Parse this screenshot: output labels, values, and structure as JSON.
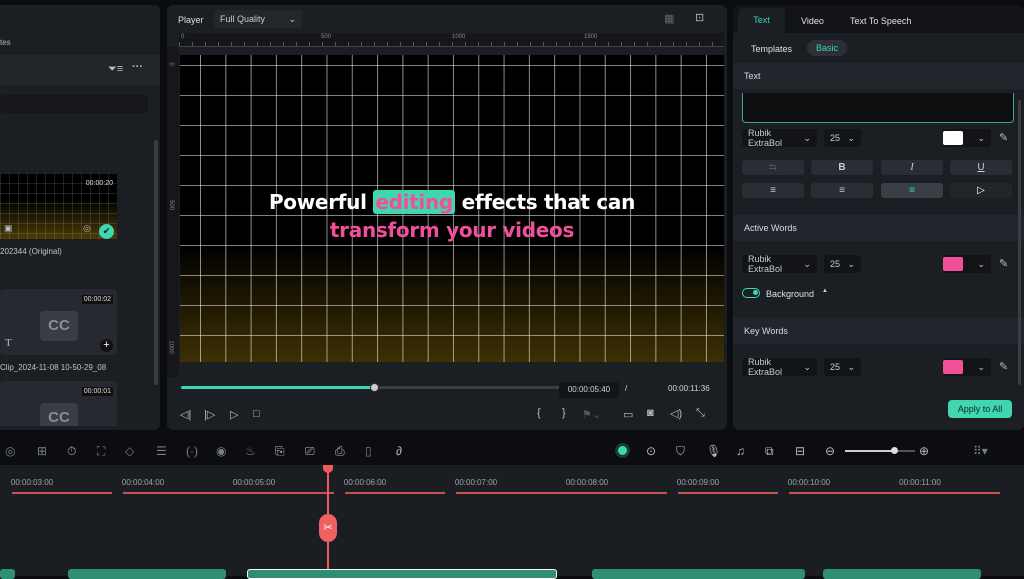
{
  "media": {
    "tab_partial": "tes",
    "clips": [
      {
        "duration": "00:00:20",
        "name": "202344 (Original)"
      },
      {
        "duration": "00:00:02",
        "name": "Clip_2024-11-08 10-50-29_08",
        "badge": "CC"
      },
      {
        "duration": "00:00:01",
        "badge": "CC"
      }
    ]
  },
  "player": {
    "label": "Player",
    "quality": "Full Quality",
    "ruler_h": [
      "0",
      "500",
      "1000",
      "1500"
    ],
    "ruler_v": [
      "0",
      "500",
      "1000"
    ],
    "caption": {
      "before": "Powerful",
      "active": "editing",
      "after": "effects that can",
      "line2": "transform your videos"
    },
    "current_time": "00:00:05:40",
    "separator": "/",
    "total_time": "00:00:11:36",
    "progress": 0.49
  },
  "props": {
    "tabs": [
      "Text",
      "Video",
      "Text To Speech"
    ],
    "active_tab": "Text",
    "subtabs": [
      "Templates",
      "Basic"
    ],
    "text_section": "Text",
    "font": "Rubik ExtraBol",
    "size": "25",
    "text_color": "#ffffff",
    "format": [
      "B",
      "I",
      "U"
    ],
    "active_words": {
      "title": "Active Words",
      "font": "Rubik ExtraBol",
      "size": "25",
      "color": "#f0509a",
      "background_label": "Background",
      "background_on": true
    },
    "key_words": {
      "title": "Key Words",
      "font": "Rubik ExtraBol",
      "size": "25",
      "color": "#f0509a"
    },
    "apply_label": "Apply to All"
  },
  "timeline": {
    "ticks": [
      "00:00:03:00",
      "00:00:04:00",
      "00:00:05:00",
      "00:00:06:00",
      "00:00:07:00",
      "00:00:08:00",
      "00:00:09:00",
      "00:00:10:00",
      "00:00:11:00"
    ],
    "zoom_level": 0.7
  },
  "colors": {
    "accent": "#3fd6b0",
    "pink": "#f0509a",
    "playhead": "#f05a5a"
  }
}
